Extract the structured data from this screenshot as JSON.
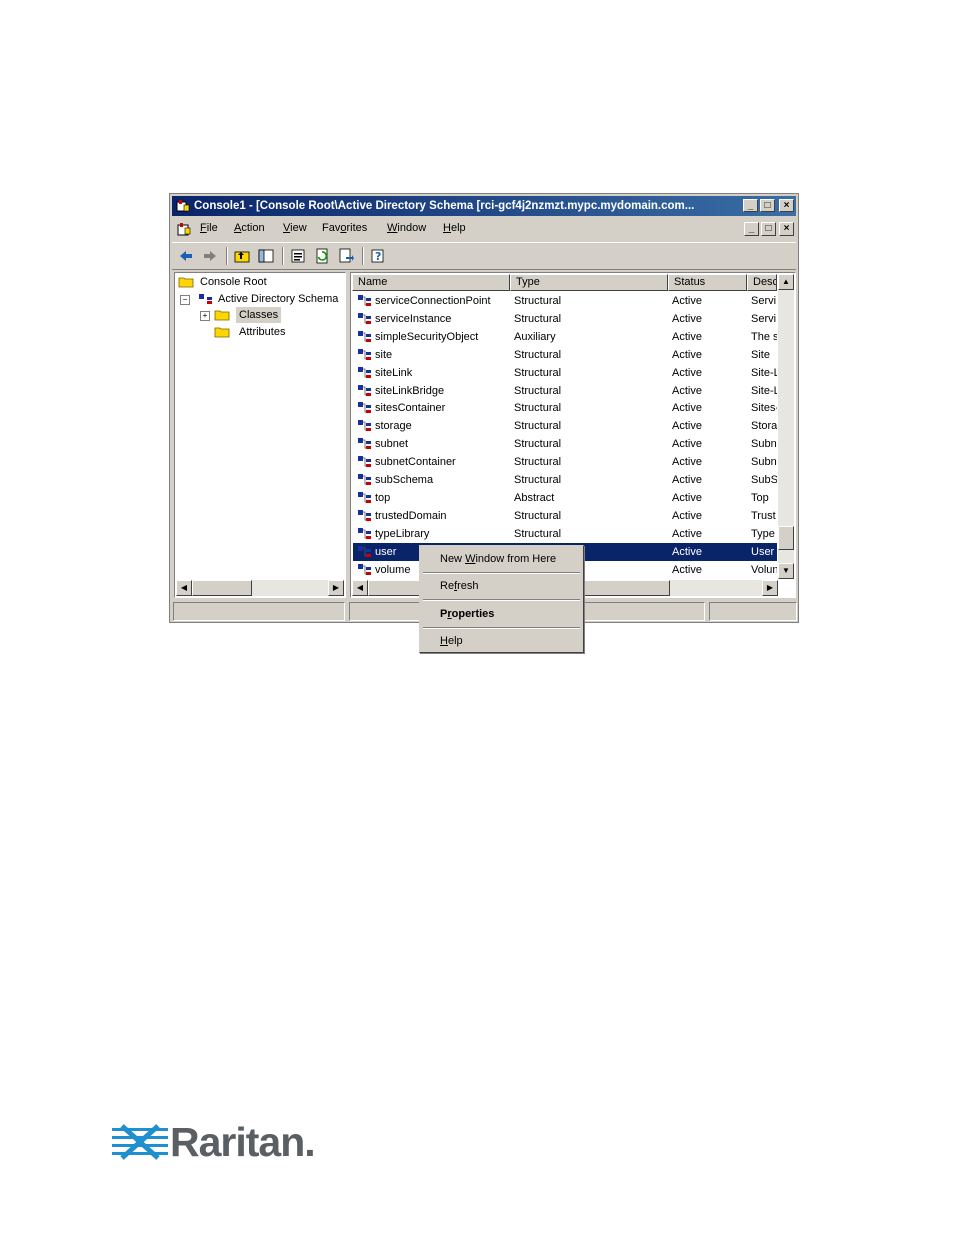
{
  "window": {
    "title": "Console1 - [Console Root\\Active Directory Schema [rci-gcf4j2nzmzt.mypc.mydomain.com...",
    "controls": {
      "minimize": "_",
      "maximize": "□",
      "close": "×"
    }
  },
  "menubar": {
    "items": [
      {
        "pre": "",
        "u": "F",
        "post": "ile"
      },
      {
        "pre": "",
        "u": "A",
        "post": "ction"
      },
      {
        "pre": "",
        "u": "V",
        "post": "iew"
      },
      {
        "pre": "Fav",
        "u": "o",
        "post": "rites"
      },
      {
        "pre": "",
        "u": "W",
        "post": "indow"
      },
      {
        "pre": "",
        "u": "H",
        "post": "elp"
      }
    ]
  },
  "tree": {
    "items": [
      {
        "label": "Console Root"
      },
      {
        "label": "Active Directory Schema"
      },
      {
        "label": "Classes"
      },
      {
        "label": "Attributes"
      }
    ]
  },
  "list": {
    "columns": [
      "Name",
      "Type",
      "Status",
      "Descri"
    ],
    "rows": [
      {
        "name": "serviceConnectionPoint",
        "type": "Structural",
        "status": "Active",
        "desc": "Servi"
      },
      {
        "name": "serviceInstance",
        "type": "Structural",
        "status": "Active",
        "desc": "Servi"
      },
      {
        "name": "simpleSecurityObject",
        "type": "Auxiliary",
        "status": "Active",
        "desc": "The s"
      },
      {
        "name": "site",
        "type": "Structural",
        "status": "Active",
        "desc": "Site"
      },
      {
        "name": "siteLink",
        "type": "Structural",
        "status": "Active",
        "desc": "Site-L"
      },
      {
        "name": "siteLinkBridge",
        "type": "Structural",
        "status": "Active",
        "desc": "Site-L"
      },
      {
        "name": "sitesContainer",
        "type": "Structural",
        "status": "Active",
        "desc": "Sites-"
      },
      {
        "name": "storage",
        "type": "Structural",
        "status": "Active",
        "desc": "Stora"
      },
      {
        "name": "subnet",
        "type": "Structural",
        "status": "Active",
        "desc": "Subn"
      },
      {
        "name": "subnetContainer",
        "type": "Structural",
        "status": "Active",
        "desc": "Subn"
      },
      {
        "name": "subSchema",
        "type": "Structural",
        "status": "Active",
        "desc": "SubS"
      },
      {
        "name": "top",
        "type": "Abstract",
        "status": "Active",
        "desc": "Top"
      },
      {
        "name": "trustedDomain",
        "type": "Structural",
        "status": "Active",
        "desc": "Trust"
      },
      {
        "name": "typeLibrary",
        "type": "Structural",
        "status": "Active",
        "desc": "Type"
      },
      {
        "name": "user",
        "type": "",
        "status": "Active",
        "desc": "User"
      },
      {
        "name": "volume",
        "type": "",
        "status": "Active",
        "desc": "Volun"
      }
    ]
  },
  "context_menu": {
    "items": [
      {
        "pre": "New ",
        "u": "W",
        "post": "indow from Here"
      },
      {
        "pre": "Re",
        "u": "f",
        "post": "resh"
      },
      {
        "pre": "P",
        "u": "r",
        "post": "operties"
      },
      {
        "pre": "",
        "u": "H",
        "post": "elp"
      }
    ]
  },
  "brand": {
    "name": "Raritan.",
    "color": "#1f8fcf"
  },
  "colors": {
    "titlebar": "#0a246a",
    "selection": "#0a246a",
    "face": "#d4d0c8"
  }
}
